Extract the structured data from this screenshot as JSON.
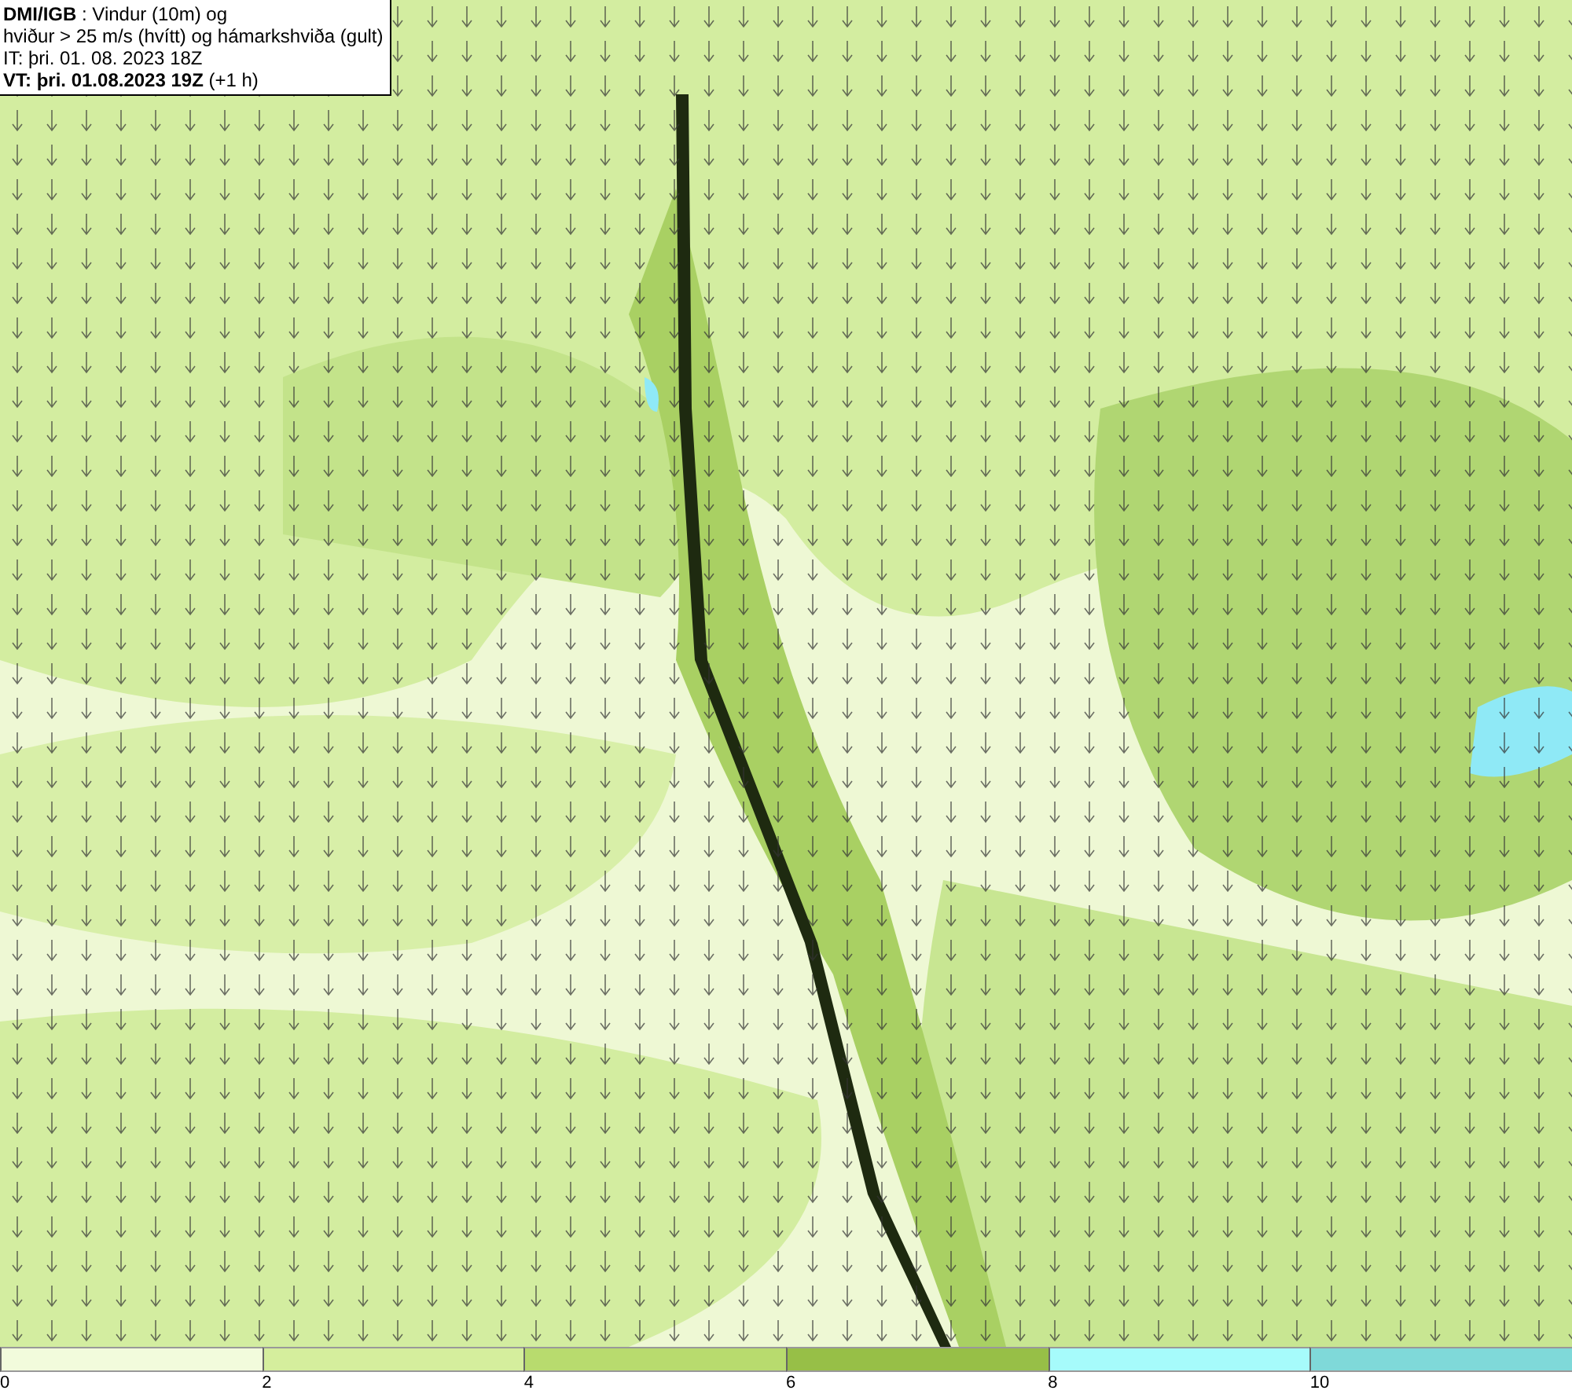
{
  "header": {
    "lines": [
      "**DMI/IGB** : Vindur (10m) og",
      "hviður > 25 m/s (hvítt) og hámarkshviða (gult)",
      "IT: þri. 01. 08. 2023 18Z",
      "**VT: þri. 01.08.2023 19Z** (+1 h)"
    ]
  },
  "legend": {
    "bins": [
      {
        "label": "0",
        "color": "#f2fbdc"
      },
      {
        "label": "2",
        "color": "#d5ee9d"
      },
      {
        "label": "4",
        "color": "#b8db6e"
      },
      {
        "label": "6",
        "color": "#97bf47"
      },
      {
        "label": "8",
        "color": "#a6fbfb"
      },
      {
        "label": "10",
        "color": "#7fd9d9"
      }
    ]
  }
}
